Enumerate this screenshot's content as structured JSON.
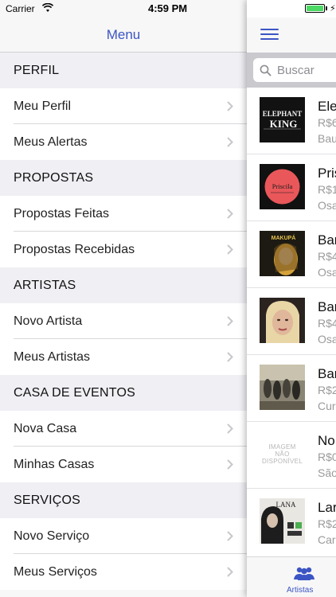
{
  "status_bar": {
    "carrier": "Carrier",
    "time": "4:59 PM",
    "battery_level": 1.0
  },
  "menu": {
    "title": "Menu",
    "sections": [
      {
        "header": "PERFIL",
        "items": [
          {
            "label": "Meu Perfil"
          },
          {
            "label": "Meus Alertas"
          }
        ]
      },
      {
        "header": "PROPOSTAS",
        "items": [
          {
            "label": "Propostas Feitas"
          },
          {
            "label": "Propostas Recebidas"
          }
        ]
      },
      {
        "header": "ARTISTAS",
        "items": [
          {
            "label": "Novo Artista"
          },
          {
            "label": "Meus Artistas"
          }
        ]
      },
      {
        "header": "CASA DE EVENTOS",
        "items": [
          {
            "label": "Nova Casa"
          },
          {
            "label": "Minhas Casas"
          }
        ]
      },
      {
        "header": "SERVIÇOS",
        "items": [
          {
            "label": "Novo Serviço"
          },
          {
            "label": "Meus Serviços"
          }
        ]
      }
    ]
  },
  "content": {
    "search": {
      "placeholder": "Buscar"
    },
    "artists": [
      {
        "name": "Ele",
        "price": "R$6",
        "city": "Bau",
        "thumb": "elephant-king",
        "thumb_text": [
          "ELEPHANT",
          "KING"
        ]
      },
      {
        "name": "Pris",
        "price": "R$1",
        "city": "Osa",
        "thumb": "priscila",
        "thumb_text": [
          "Priscila"
        ]
      },
      {
        "name": "Bar",
        "price": "R$4",
        "city": "Osa",
        "thumb": "makupa",
        "thumb_text": [
          "MAKUPÁ"
        ]
      },
      {
        "name": "Bar",
        "price": "R$4",
        "city": "Osa",
        "thumb": "portrait",
        "thumb_text": []
      },
      {
        "name": "Bar",
        "price": "R$2",
        "city": "Cur",
        "thumb": "band",
        "thumb_text": []
      },
      {
        "name": "No",
        "price": "R$0",
        "city": "São",
        "thumb": "no-image",
        "thumb_text": [
          "IMAGEM",
          "NÃO",
          "DISPONÍVEL"
        ]
      },
      {
        "name": "Lar",
        "price": "R$2",
        "city": "Car",
        "thumb": "lana",
        "thumb_text": [
          "LANA"
        ]
      }
    ],
    "tabbar": {
      "label": "Artistas"
    }
  },
  "colors": {
    "accent": "#3b55c4",
    "battery": "#4cd964",
    "section_bg": "#efeff4"
  }
}
